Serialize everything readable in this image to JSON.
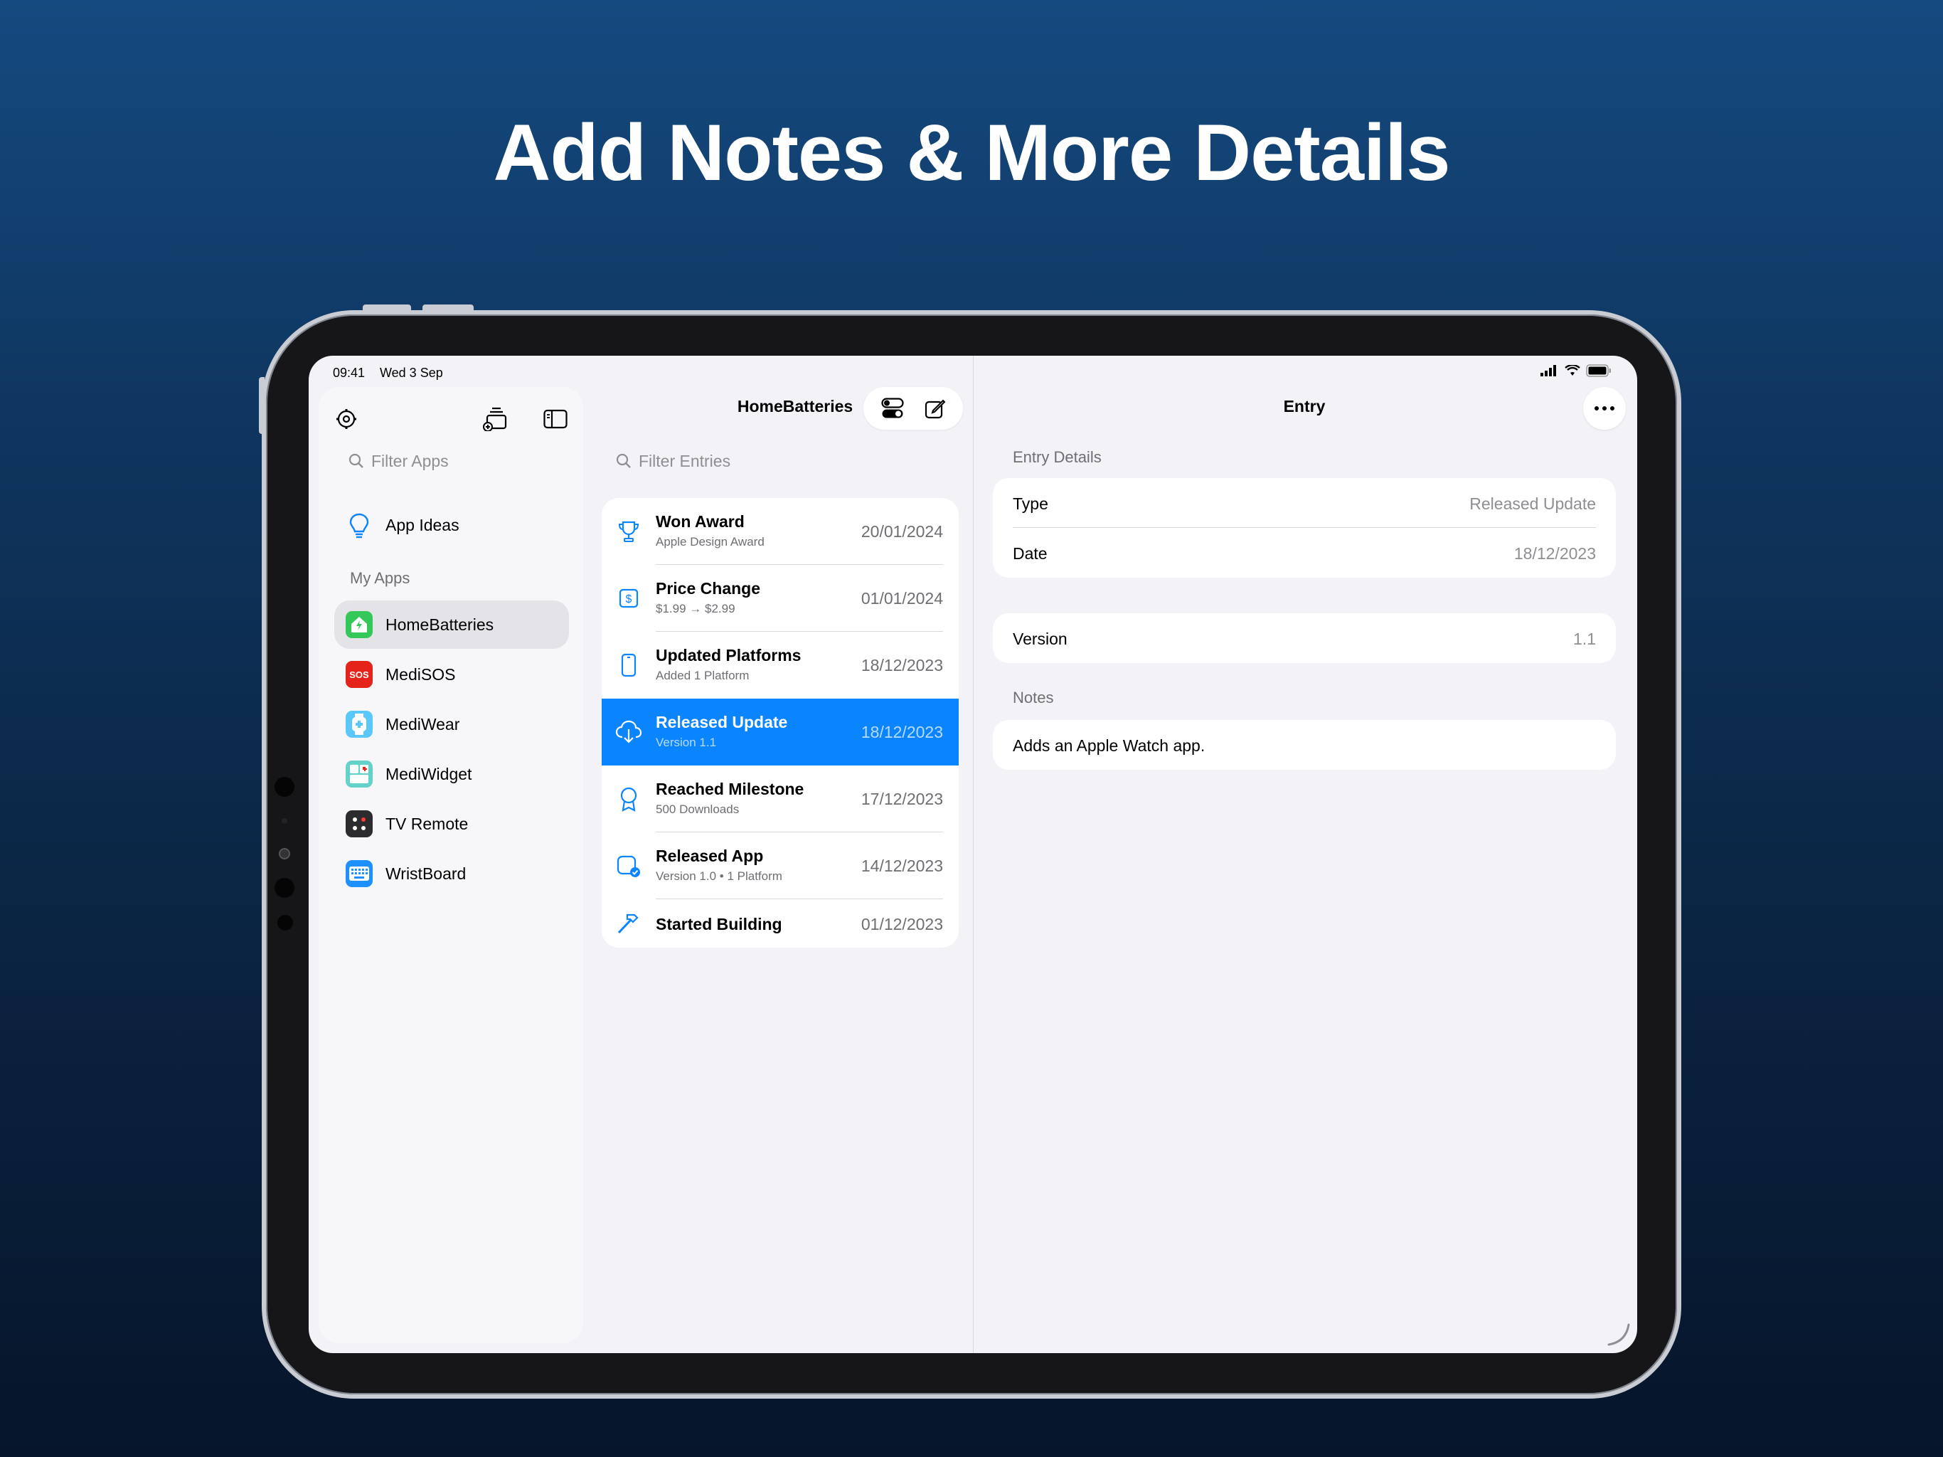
{
  "headline": "Add Notes & More Details",
  "status": {
    "time": "09:41",
    "date": "Wed 3 Sep"
  },
  "sidebar": {
    "search_placeholder": "Filter Apps",
    "ideas_label": "App Ideas",
    "section_label": "My Apps",
    "apps": [
      {
        "label": "HomeBatteries",
        "icon": "home-battery-icon",
        "color": "#34c759",
        "selected": true
      },
      {
        "label": "MediSOS",
        "icon": "sos-icon",
        "color": "#e5231b"
      },
      {
        "label": "MediWear",
        "icon": "watch-medical-icon",
        "color": "#5ac8fa"
      },
      {
        "label": "MediWidget",
        "icon": "widget-medical-icon",
        "color": "#64d2c8"
      },
      {
        "label": "TV Remote",
        "icon": "remote-icon",
        "color": "#2c2c2e"
      },
      {
        "label": "WristBoard",
        "icon": "keyboard-icon",
        "color": "#1e90ff"
      }
    ]
  },
  "entries": {
    "title": "HomeBatteries",
    "search_placeholder": "Filter Entries",
    "rows": [
      {
        "title": "Won Award",
        "subtitle": "Apple Design Award",
        "date": "20/01/2024",
        "icon": "trophy-icon"
      },
      {
        "title": "Price Change",
        "subtitle": "$1.99 → $2.99",
        "date": "01/01/2024",
        "icon": "dollar-icon"
      },
      {
        "title": "Updated Platforms",
        "subtitle": "Added 1 Platform",
        "date": "18/12/2023",
        "icon": "phone-icon"
      },
      {
        "title": "Released Update",
        "subtitle": "Version 1.1",
        "date": "18/12/2023",
        "icon": "cloud-download-icon",
        "selected": true
      },
      {
        "title": "Reached Milestone",
        "subtitle": "500 Downloads",
        "date": "17/12/2023",
        "icon": "ribbon-icon"
      },
      {
        "title": "Released App",
        "subtitle": "Version 1.0 • 1 Platform",
        "date": "14/12/2023",
        "icon": "app-check-icon"
      },
      {
        "title": "Started Building",
        "subtitle": "",
        "date": "01/12/2023",
        "icon": "hammer-icon"
      }
    ]
  },
  "detail": {
    "title": "Entry",
    "section_details": "Entry Details",
    "type_key": "Type",
    "type_value": "Released Update",
    "date_key": "Date",
    "date_value": "18/12/2023",
    "version_key": "Version",
    "version_value": "1.1",
    "section_notes": "Notes",
    "notes_text": "Adds an Apple Watch app."
  },
  "colors": {
    "accent": "#0a84ff",
    "background_top": "#154a80",
    "background_bottom": "#06152a"
  }
}
